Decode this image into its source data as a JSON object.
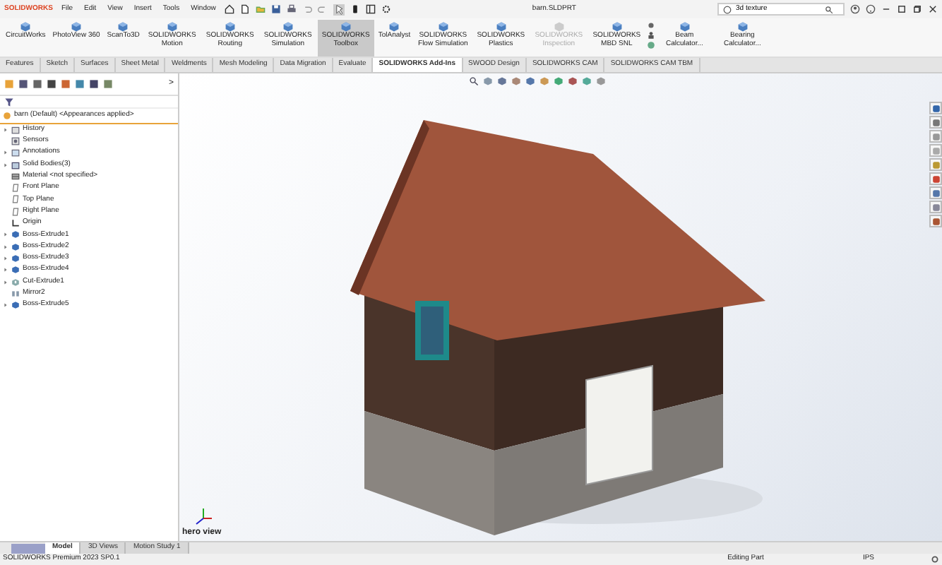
{
  "app": {
    "logo": "SOLIDWORKS"
  },
  "menu": [
    "File",
    "Edit",
    "View",
    "Insert",
    "Tools",
    "Window"
  ],
  "document_title": "barn.SLDPRT",
  "search": {
    "value": "3d texture"
  },
  "ribbon": [
    {
      "label": "CircuitWorks",
      "selected": false,
      "disabled": false
    },
    {
      "label": "PhotoView 360",
      "selected": false,
      "disabled": false
    },
    {
      "label": "ScanTo3D",
      "selected": false,
      "disabled": false
    },
    {
      "label": "SOLIDWORKS Motion",
      "selected": false,
      "disabled": false
    },
    {
      "label": "SOLIDWORKS Routing",
      "selected": false,
      "disabled": false
    },
    {
      "label": "SOLIDWORKS Simulation",
      "selected": false,
      "disabled": false
    },
    {
      "label": "SOLIDWORKS Toolbox",
      "selected": true,
      "disabled": false
    },
    {
      "label": "TolAnalyst",
      "selected": false,
      "disabled": false
    },
    {
      "label": "SOLIDWORKS Flow Simulation",
      "selected": false,
      "disabled": false
    },
    {
      "label": "SOLIDWORKS Plastics",
      "selected": false,
      "disabled": false
    },
    {
      "label": "SOLIDWORKS Inspection",
      "selected": false,
      "disabled": true
    },
    {
      "label": "SOLIDWORKS MBD SNL",
      "selected": false,
      "disabled": false
    },
    {
      "label": "Beam Calculator...",
      "selected": false,
      "disabled": false
    },
    {
      "label": "Bearing Calculator...",
      "selected": false,
      "disabled": false
    }
  ],
  "tabs": [
    {
      "label": "Features",
      "selected": false
    },
    {
      "label": "Sketch",
      "selected": false
    },
    {
      "label": "Surfaces",
      "selected": false
    },
    {
      "label": "Sheet Metal",
      "selected": false
    },
    {
      "label": "Weldments",
      "selected": false
    },
    {
      "label": "Mesh Modeling",
      "selected": false
    },
    {
      "label": "Data Migration",
      "selected": false
    },
    {
      "label": "Evaluate",
      "selected": false
    },
    {
      "label": "SOLIDWORKS Add-Ins",
      "selected": true
    },
    {
      "label": "SWOOD Design",
      "selected": false
    },
    {
      "label": "SOLIDWORKS CAM",
      "selected": false
    },
    {
      "label": "SOLIDWORKS CAM TBM",
      "selected": false
    }
  ],
  "feature_tree": {
    "more": ">",
    "root": "barn (Default) <Appearances applied>",
    "items": [
      {
        "label": "History",
        "kind": "folder",
        "expandable": true
      },
      {
        "label": "Sensors",
        "kind": "sensor",
        "expandable": false
      },
      {
        "label": "Annotations",
        "kind": "annotation",
        "expandable": true
      },
      {
        "label": "Solid Bodies(3)",
        "kind": "bodies",
        "expandable": true
      },
      {
        "label": "Material <not specified>",
        "kind": "material",
        "expandable": false
      },
      {
        "label": "Front Plane",
        "kind": "plane",
        "expandable": false
      },
      {
        "label": "Top Plane",
        "kind": "plane",
        "expandable": false
      },
      {
        "label": "Right Plane",
        "kind": "plane",
        "expandable": false
      },
      {
        "label": "Origin",
        "kind": "origin",
        "expandable": false
      },
      {
        "label": "Boss-Extrude1",
        "kind": "feature",
        "expandable": true
      },
      {
        "label": "Boss-Extrude2",
        "kind": "feature",
        "expandable": true
      },
      {
        "label": "Boss-Extrude3",
        "kind": "feature",
        "expandable": true
      },
      {
        "label": "Boss-Extrude4",
        "kind": "feature",
        "expandable": true
      },
      {
        "label": "Cut-Extrude1",
        "kind": "cut",
        "expandable": true
      },
      {
        "label": "Mirror2",
        "kind": "mirror",
        "expandable": false
      },
      {
        "label": "Boss-Extrude5",
        "kind": "feature",
        "expandable": true
      }
    ]
  },
  "viewport": {
    "caption": "hero view"
  },
  "bottom_tabs": [
    {
      "label": "Model",
      "selected": true
    },
    {
      "label": "3D Views",
      "selected": false
    },
    {
      "label": "Motion Study 1",
      "selected": false
    }
  ],
  "status_bar": {
    "product": "SOLIDWORKS Premium 2023 SP0.1",
    "mode": "Editing Part",
    "units": "IPS"
  }
}
